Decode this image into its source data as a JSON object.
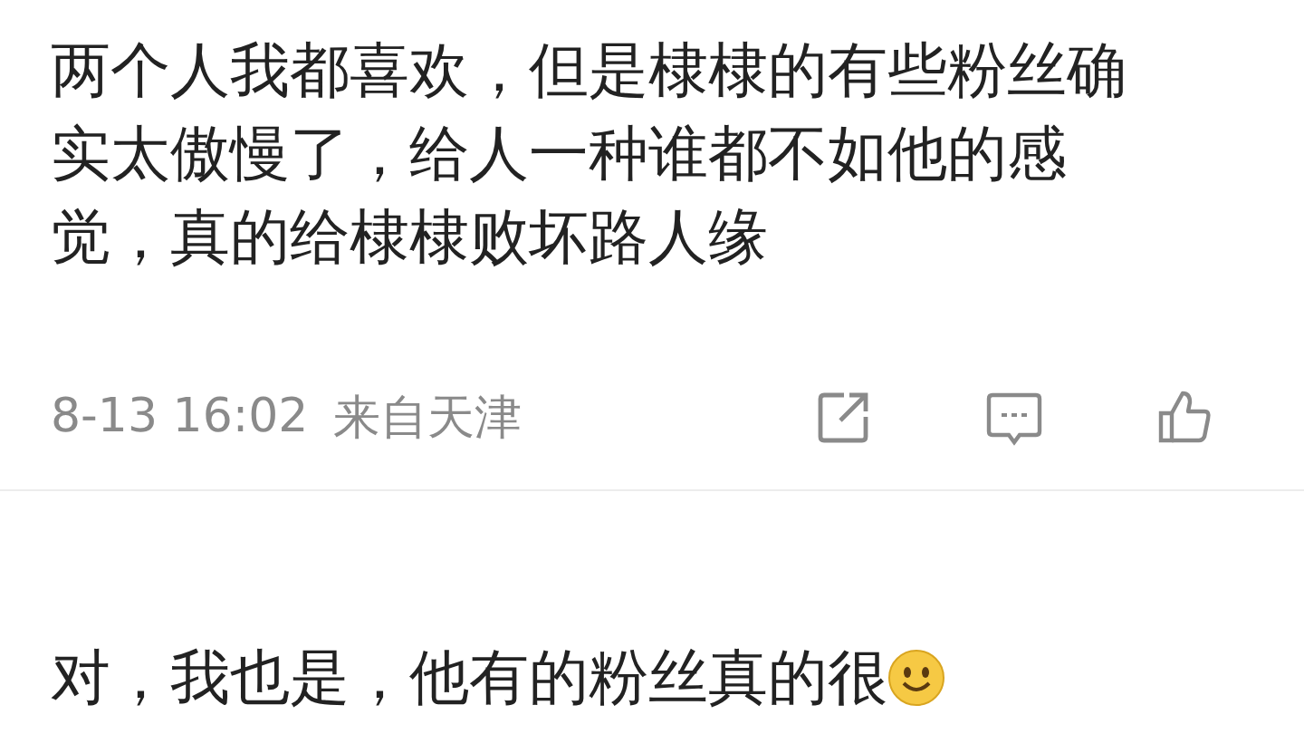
{
  "comments": [
    {
      "kind": "with_meta",
      "text": "两个人我都喜欢，但是棣棣的有些粉丝确实太傲慢了，给人一种谁都不如他的感觉，真的给棣棣败坏路人缘",
      "time": "8-13 16:02",
      "location": "来自天津"
    },
    {
      "kind": "with_emoji",
      "text": "对，我也是，他有的粉丝真的很"
    }
  ]
}
